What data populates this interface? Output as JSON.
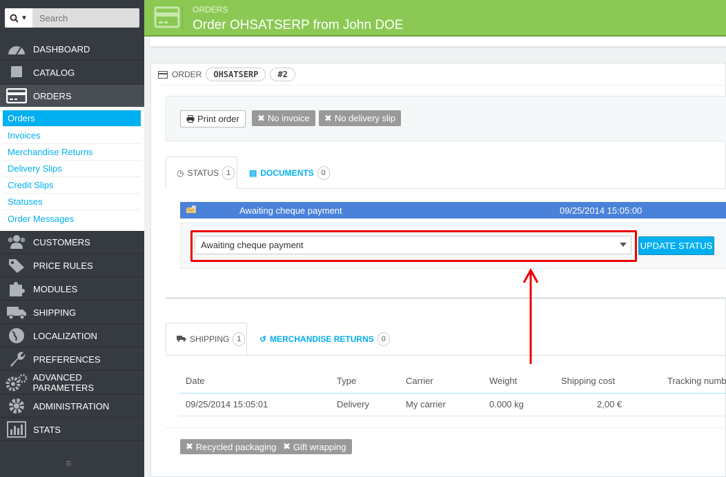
{
  "search": {
    "placeholder": "Search"
  },
  "sidebar": {
    "items": [
      {
        "label": "DASHBOARD",
        "icon": "dashboard-icon"
      },
      {
        "label": "CATALOG",
        "icon": "book-icon"
      },
      {
        "label": "ORDERS",
        "icon": "credit-card-icon"
      },
      {
        "label": "CUSTOMERS",
        "icon": "users-icon"
      },
      {
        "label": "PRICE RULES",
        "icon": "tags-icon"
      },
      {
        "label": "MODULES",
        "icon": "puzzle-icon"
      },
      {
        "label": "SHIPPING",
        "icon": "truck-icon"
      },
      {
        "label": "LOCALIZATION",
        "icon": "globe-icon"
      },
      {
        "label": "PREFERENCES",
        "icon": "wrench-icon"
      },
      {
        "label": "ADVANCED PARAMETERS",
        "icon": "cogs-icon"
      },
      {
        "label": "ADMINISTRATION",
        "icon": "cog-icon"
      },
      {
        "label": "STATS",
        "icon": "bar-chart-icon"
      }
    ],
    "submenu": [
      "Orders",
      "Invoices",
      "Merchandise Returns",
      "Delivery Slips",
      "Credit Slips",
      "Statuses",
      "Order Messages"
    ]
  },
  "header": {
    "breadcrumb": "ORDERS",
    "title": "Order OHSATSERP from John DOE"
  },
  "order": {
    "label": "ORDER",
    "reference": "OHSATSERP",
    "number": "#2"
  },
  "documents": {
    "print": "Print order",
    "no_invoice": "No invoice",
    "no_delivery": "No delivery slip"
  },
  "tabs1": {
    "status": "STATUS",
    "status_count": "1",
    "documents": "DOCUMENTS",
    "documents_count": "0"
  },
  "status": {
    "current": "Awaiting cheque payment",
    "date": "09/25/2014 15:05:00",
    "select_value": "Awaiting cheque payment",
    "update_button": "UPDATE STATUS",
    "row_color": "#4a81d9"
  },
  "tabs2": {
    "shipping": "SHIPPING",
    "shipping_count": "1",
    "returns": "MERCHANDISE RETURNS",
    "returns_count": "0"
  },
  "shipping_table": {
    "headers": [
      "Date",
      "Type",
      "Carrier",
      "Weight",
      "Shipping cost",
      "Tracking numbe"
    ],
    "rows": [
      [
        "09/25/2014 15:05:01",
        "Delivery",
        "My carrier",
        "0.000 kg",
        "2,00 €",
        ""
      ]
    ]
  },
  "footer_buttons": {
    "recycled": "Recycled packaging",
    "gift": "Gift wrapping"
  },
  "colors": {
    "accent": "#00aff0",
    "header": "#8bc954",
    "annotation": "#e00000"
  }
}
